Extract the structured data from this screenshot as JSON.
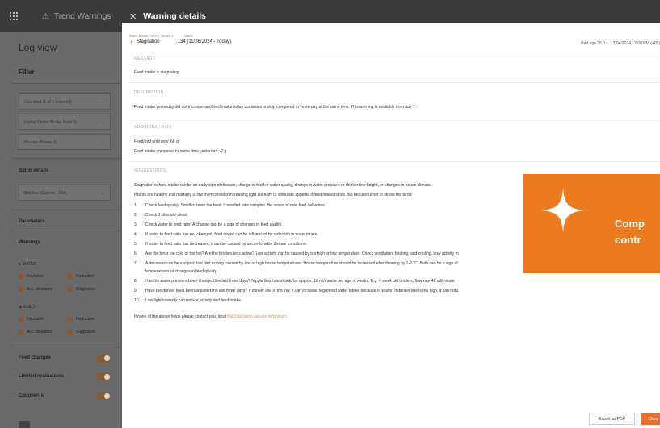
{
  "topbar": {
    "app_title": "Trend Warnings",
    "panel_title": "Warning details"
  },
  "sidebar": {
    "title": "Log view",
    "filter_label": "Filter",
    "countries": "Countries (1 of 7 selected)",
    "farms": "Farms (Demo Broiler Farm 1)",
    "houses": "Houses (House 1)",
    "batch_details": "Batch details",
    "batches": "Batches (Current - 134)",
    "parameters": "Parameters",
    "warnings": "Warnings",
    "water_label": "WATER",
    "feed_label": "FEED",
    "water_checks": [
      "Deviation",
      "Reduction",
      "Acc. deviation",
      "Stagnation"
    ],
    "feed_checks": [
      "Deviation",
      "Reduction",
      "Acc. deviation",
      "Stagnation"
    ],
    "feed_changes": "Feed changes",
    "limited_evaluations": "Limited evaluations",
    "comments": "Comments"
  },
  "panel": {
    "crumb_farm": "Demo Broiler Farm 1, House 1",
    "crumb_batch": "Batch",
    "warning_name": "Stagnation",
    "batch_value": "134 (11/06/2024 - Today)",
    "bird_age": "Bird age 26.0",
    "datetime": "12/04/2024 12:00 PM (+08)",
    "message_label": "MESSAGE",
    "message_text": "Feed intake is stagnating",
    "description_label": "DESCRIPTION",
    "description_text": "Feed intake yesterday did not increase and feed intake today continues to drop compared to yesterday at the same time. This warning is available from day 7.",
    "additional_label": "ADDITIONAL DATA",
    "additional_1": "Feed/bird until now: 68 g",
    "additional_2": "Feed intake compared to same time yesterday: -2 g",
    "suggestions_label": "SUGGESTIONS",
    "suggest_intro_1": "Stagnation in feed intake can be an early sign of disease, change in feed or water quality, change in water pressure or drinker line height, or changes in house climate.",
    "suggest_intro_2": "If birds are healthy and mortality is low then consider increasing light intensity to stimulate appetite if feed intake is low. But be careful not to stress the birds!",
    "suggestions": [
      {
        "n": "1.",
        "t": "Check feed quality. Smell or taste the feed. If needed take samples. Be aware of new feed deliveries."
      },
      {
        "n": "2.",
        "t": "Check if silos are clean."
      },
      {
        "n": "3.",
        "t": "Check water to feed ratio. A change can be a sign of changes in feed quality."
      },
      {
        "n": "4.",
        "t": "If water to feed ratio has not changed, feed intake can be influenced by reduction in water intake."
      },
      {
        "n": "5.",
        "t": "If water to feed ratio has decreased, it can be caused by uncomfortable climate conditions."
      },
      {
        "n": "6.",
        "t": "Are the birds too cold or too hot? Are the broilers less active? Low activity can be caused by too high or low temperature. Check ventilation, heating, and cooling. Low activity m"
      },
      {
        "n": "7.",
        "t": "A decrease can be a sign of low bird activity caused by low or high house temperatures. House temperature should be increased after thinning by 1-2 °C. Both can be a sign of"
      },
      {
        "n": "",
        "t": "temperatures or changes in feed quality."
      },
      {
        "n": "8.",
        "t": "Has the water pressure been changed the last three days? Nipple flow rate should be approx. 10 ml/minute per age in weeks. E.g. 4 week old broilers, flow rate 40 ml/minute."
      },
      {
        "n": "9.",
        "t": "Have the drinker lines been adjusted the last three days? If drinker line is too low, it can increase registered water intake because of waste. If drinker line is too high, it can redu"
      },
      {
        "n": "10.",
        "t": "Low light intensity can reduce activity and feed intake."
      }
    ],
    "contact_prefix": "If none of the above helps please contact your local",
    "contact_link": "Big Dutchman service technician",
    "contact_suffix": ".",
    "export_label": "Export as PDF",
    "close_label": "Close"
  },
  "promo": {
    "line1": "Comp",
    "line2": "contr"
  },
  "colors": {
    "accent": "#ec7a1f",
    "topbar": "#3a3a3a"
  }
}
